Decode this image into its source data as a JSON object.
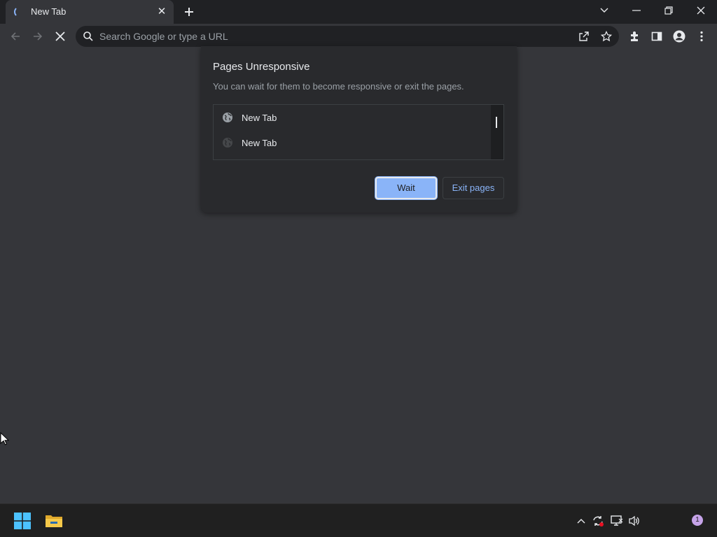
{
  "browser": {
    "tab": {
      "title": "New Tab",
      "close_glyph": "✕"
    },
    "omnibox": {
      "placeholder": "Search Google or type a URL"
    }
  },
  "dialog": {
    "title": "Pages Unresponsive",
    "description": "You can wait for them to become responsive or exit the pages.",
    "pages": [
      {
        "label": "New Tab",
        "icon": "globe-icon"
      },
      {
        "label": "New Tab",
        "icon": "globe-icon"
      }
    ],
    "wait_label": "Wait",
    "exit_label": "Exit pages"
  },
  "taskbar": {
    "notification_count": "1"
  },
  "colors": {
    "accent": "#8ab4f8",
    "background": "#35363a",
    "dialog": "#292a2d"
  }
}
